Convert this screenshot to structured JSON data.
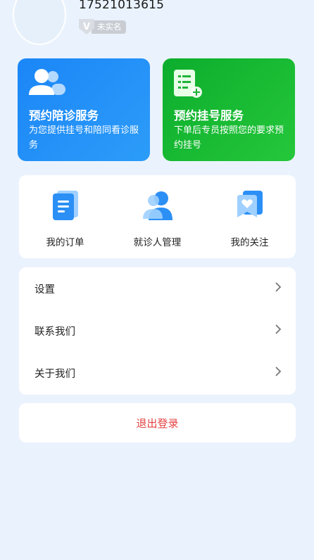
{
  "profile": {
    "phone": "17521013615",
    "badge_letter": "V",
    "verify_status": "未实名"
  },
  "service_cards": [
    {
      "title": "预约陪诊服务",
      "desc": "为您提供挂号和陪同看诊服务",
      "color": "#1b86f7",
      "icon": "users-icon"
    },
    {
      "title": "预约挂号服务",
      "desc": "下单后专员按照您的要求预约挂号",
      "color": "#0cad2d",
      "icon": "document-add-icon"
    }
  ],
  "quick_actions": [
    {
      "label": "我的订单",
      "icon": "order-icon"
    },
    {
      "label": "就诊人管理",
      "icon": "patient-icon"
    },
    {
      "label": "我的关注",
      "icon": "follow-heart-icon"
    }
  ],
  "menu": [
    {
      "label": "设置"
    },
    {
      "label": "联系我们"
    },
    {
      "label": "关于我们"
    }
  ],
  "logout_label": "退出登录",
  "colors": {
    "background": "#eaf3fd",
    "logout": "#e34242",
    "blue_accent": "#1b86f7",
    "green_accent": "#0cad2d"
  }
}
